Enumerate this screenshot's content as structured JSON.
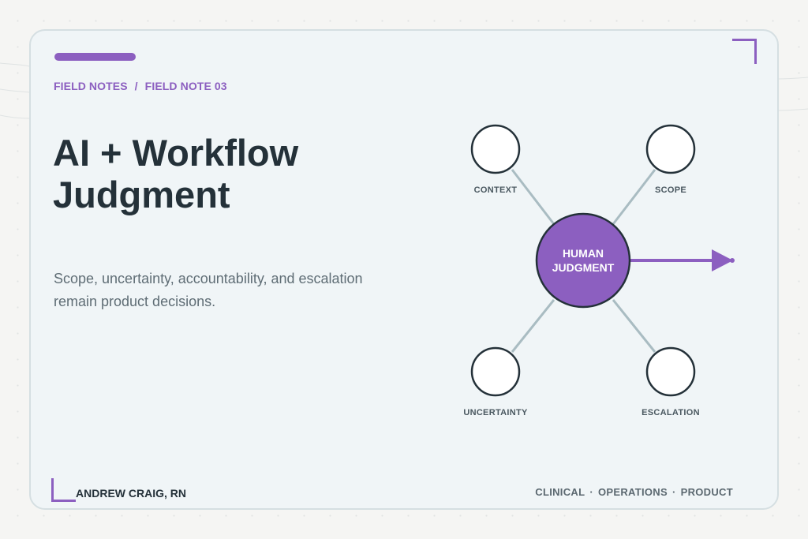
{
  "breadcrumb": {
    "section": "FIELD NOTES",
    "separator": "/",
    "item": "FIELD NOTE 03"
  },
  "title": {
    "line1": "AI + Workflow",
    "line2": "Judgment"
  },
  "subtitle": {
    "line1": "Scope, uncertainty, accountability, and escalation",
    "line2": "remain product decisions."
  },
  "diagram": {
    "hub": {
      "line1": "HUMAN",
      "line2": "JUDGMENT"
    },
    "nodes": {
      "top_left": "CONTEXT",
      "top_right": "SCOPE",
      "bottom_left": "UNCERTAINTY",
      "bottom_right": "ESCALATION"
    }
  },
  "footer": {
    "author": "ANDREW CRAIG, RN",
    "tags": [
      "CLINICAL",
      "OPERATIONS",
      "PRODUCT"
    ],
    "tag_separator": "·"
  },
  "colors": {
    "accent": "#8c5fc0",
    "heading": "#243139",
    "body_text": "#5f6d75",
    "connector": "#a9bcc2",
    "card_background": "#f0f5f7"
  }
}
